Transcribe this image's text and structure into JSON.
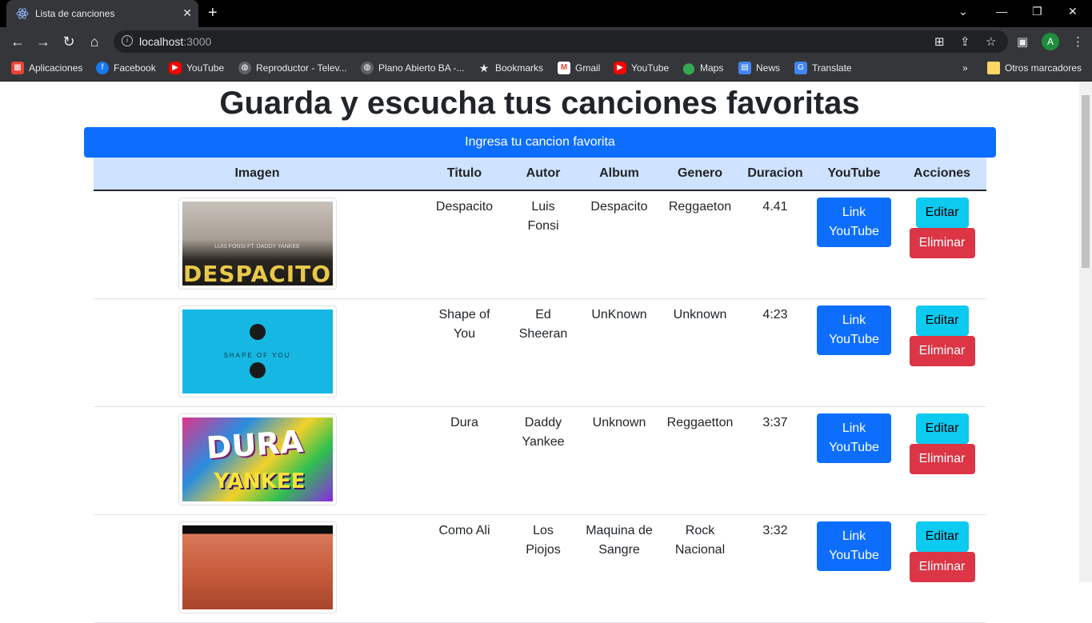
{
  "browser": {
    "tab_title": "Lista de canciones",
    "url_host": "localhost",
    "url_port": ":3000",
    "avatar_letter": "A",
    "bookmarks": [
      {
        "label": "Aplicaciones",
        "icon": "apps-grid-icon",
        "color": "#ea4335"
      },
      {
        "label": "Facebook",
        "icon": "facebook-icon",
        "color": "#1877f2"
      },
      {
        "label": "YouTube",
        "icon": "youtube-icon",
        "color": "#ff0000"
      },
      {
        "label": "Reproductor - Telev...",
        "icon": "globe-icon",
        "color": "#e8eaed"
      },
      {
        "label": "Plano Abierto BA -...",
        "icon": "globe-icon",
        "color": "#e8eaed"
      },
      {
        "label": "Bookmarks",
        "icon": "star-icon",
        "color": "#e8eaed"
      },
      {
        "label": "Gmail",
        "icon": "gmail-icon",
        "color": "#ea4335"
      },
      {
        "label": "YouTube",
        "icon": "youtube-icon",
        "color": "#ff0000"
      },
      {
        "label": "Maps",
        "icon": "maps-pin-icon",
        "color": "#34a853"
      },
      {
        "label": "News",
        "icon": "news-icon",
        "color": "#4285f4"
      },
      {
        "label": "Translate",
        "icon": "translate-icon",
        "color": "#4285f4"
      }
    ],
    "other_bookmarks": "Otros marcadores"
  },
  "page": {
    "title": "Guarda y escucha tus canciones favoritas",
    "add_button": "Ingresa tu cancion favorita",
    "columns": [
      "Imagen",
      "Titulo",
      "Autor",
      "Album",
      "Genero",
      "Duracion",
      "YouTube",
      "Acciones"
    ],
    "songs": [
      {
        "title": "Despacito",
        "author": "Luis Fonsi",
        "album": "Despacito",
        "genre": "Reggaeton",
        "duration": "4.41",
        "cover_text": "DESPACITO",
        "cover_sub": "LUIS FONSI FT. DADDY YANKEE"
      },
      {
        "title": "Shape of You",
        "author": "Ed Sheeran",
        "album": "UnKnown",
        "genre": "Unknown",
        "duration": "4:23",
        "cover_text": "SHAPE OF YOU"
      },
      {
        "title": "Dura",
        "author": "Daddy Yankee",
        "album": "Unknown",
        "genre": "Reggaetton",
        "duration": "3:37",
        "cover_text": "DURA",
        "cover_sub": "YANKEE"
      },
      {
        "title": "Como Ali",
        "author": "Los Piojos",
        "album": "Maquina de Sangre",
        "genre": "Rock Nacional",
        "duration": "3:32"
      }
    ],
    "youtube_button": "Link YouTube",
    "edit_button": "Editar",
    "delete_button": "Eliminar"
  }
}
